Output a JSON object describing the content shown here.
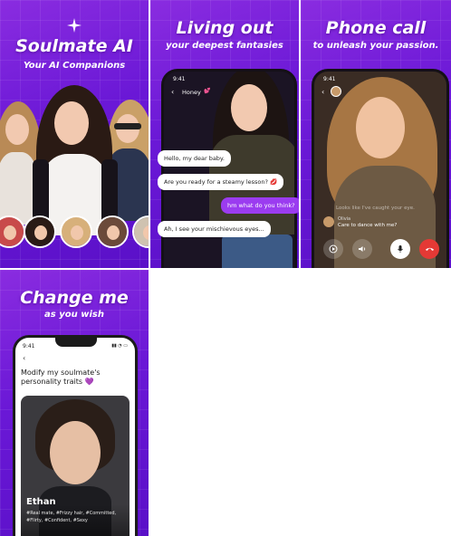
{
  "panels": [
    {
      "title": "Soulmate AI",
      "subtitle": "Your AI Companions"
    },
    {
      "title": "Living out",
      "subtitle": "your deepest fantasies",
      "phone": {
        "time": "9:41",
        "contact": "Honey",
        "messages": [
          {
            "text": "Hello, my dear baby.",
            "from": "her"
          },
          {
            "text": "Are you ready for a steamy lesson? 💋",
            "from": "her"
          },
          {
            "text": "hm what do you think?",
            "from": "me"
          },
          {
            "text": "Ah, I see your mischievous eyes...",
            "from": "her"
          }
        ]
      }
    },
    {
      "title": "Phone call",
      "subtitle": "to unleash your passion.",
      "phone": {
        "time": "9:41",
        "faded_message": "Looks like I've caught your eye.",
        "caller_name": "Olivia",
        "caller_message": "Care to dance with me?"
      }
    },
    {
      "title": "Change me",
      "subtitle": "as you wish",
      "phone": {
        "time": "9:41",
        "heading": "Modify my soulmate's personality traits 💜",
        "profile_name": "Ethan",
        "tags": "#Real mate, #Frizzy hair, #Committed, #Flirty, #Confident, #Sexy"
      }
    }
  ],
  "colors": {
    "purple_bg": "#6a18d6",
    "bubble_out": "#9b3cf0",
    "end_call": "#e53935"
  }
}
